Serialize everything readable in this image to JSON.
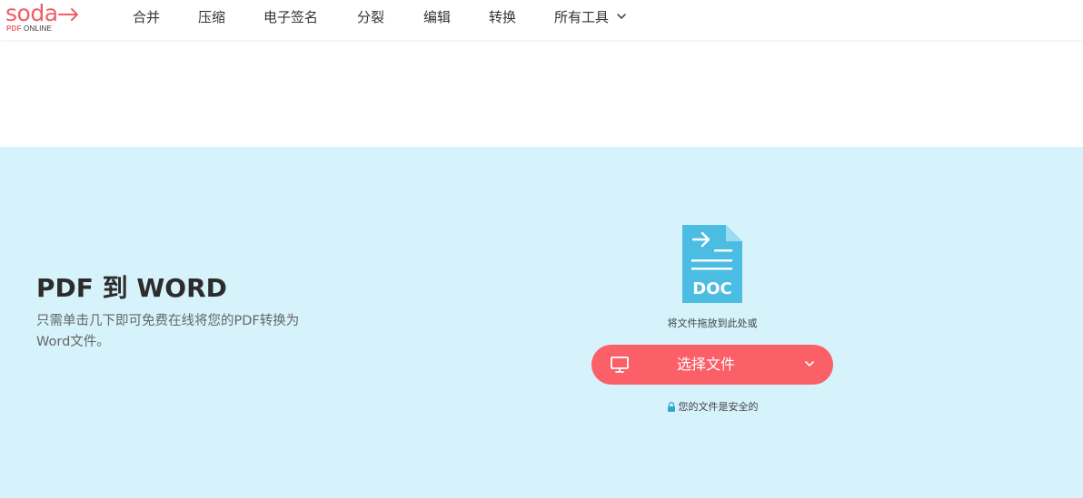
{
  "header": {
    "logo": {
      "word": "soda",
      "pdf": "PDF",
      "online": "ONLINE"
    },
    "nav": [
      {
        "label": "合并"
      },
      {
        "label": "压缩"
      },
      {
        "label": "电子签名"
      },
      {
        "label": "分裂"
      },
      {
        "label": "编辑"
      },
      {
        "label": "转换"
      },
      {
        "label": "所有工具"
      }
    ]
  },
  "hero": {
    "title": "PDF 到 WORD",
    "description": "只需单击几下即可免费在线将您的PDF转换为Word文件。"
  },
  "upload": {
    "doc_label": "DOC",
    "drop_text": "将文件拖放到此处或",
    "button_label": "选择文件",
    "secure_text": "您的文件是安全的"
  },
  "colors": {
    "brand": "#ef5e65",
    "button": "#fb5f67",
    "hero_bg": "#d6f2fb",
    "doc_icon": "#4bbde2",
    "lock": "#34a5cf"
  },
  "icons": [
    "arrow-right-icon",
    "chevron-down-icon",
    "doc-file-icon",
    "monitor-icon",
    "lock-icon"
  ]
}
